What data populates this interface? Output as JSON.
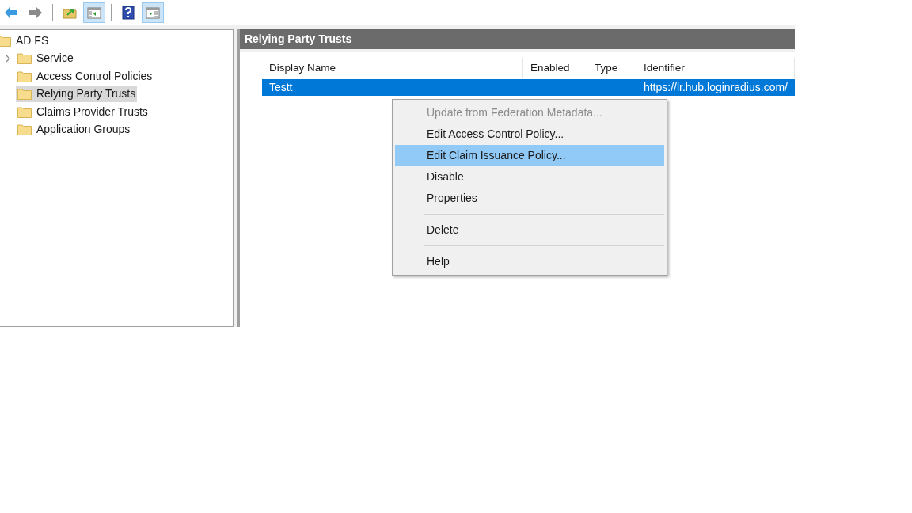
{
  "toolbar": [
    {
      "kind": "back",
      "pressed": false
    },
    {
      "kind": "forward",
      "pressed": false
    },
    {
      "kind": "sep"
    },
    {
      "kind": "up",
      "pressed": false
    },
    {
      "kind": "tree",
      "pressed": true
    },
    {
      "kind": "sep"
    },
    {
      "kind": "help",
      "pressed": false
    },
    {
      "kind": "action",
      "pressed": true
    }
  ],
  "tree": {
    "label": "AD FS",
    "selected": false,
    "children": [
      {
        "label": "Service",
        "expandable": true,
        "selected": false
      },
      {
        "label": "Access Control Policies",
        "expandable": false,
        "selected": false
      },
      {
        "label": "Relying Party Trusts",
        "expandable": false,
        "selected": true
      },
      {
        "label": "Claims Provider Trusts",
        "expandable": false,
        "selected": false
      },
      {
        "label": "Application Groups",
        "expandable": false,
        "selected": false
      }
    ]
  },
  "pane": {
    "title": "Relying Party Trusts",
    "columns": [
      "Display Name",
      "Enabled",
      "Type",
      "Identifier"
    ],
    "rows": [
      {
        "display_name": "Testt",
        "identifier": "https://lr.hub.loginradius.com/",
        "selected": true
      }
    ]
  },
  "context_menu": [
    {
      "kind": "item",
      "label": "Update from Federation Metadata...",
      "disabled": true,
      "selected": false
    },
    {
      "kind": "item",
      "label": "Edit Access Control Policy...",
      "disabled": false,
      "selected": false
    },
    {
      "kind": "item",
      "label": "Edit Claim Issuance Policy...",
      "disabled": false,
      "selected": true
    },
    {
      "kind": "item",
      "label": "Disable",
      "disabled": false,
      "selected": false
    },
    {
      "kind": "item",
      "label": "Properties",
      "disabled": false,
      "selected": false
    },
    {
      "kind": "separator"
    },
    {
      "kind": "item",
      "label": "Delete",
      "disabled": false,
      "selected": false
    },
    {
      "kind": "separator"
    },
    {
      "kind": "item",
      "label": "Help",
      "disabled": false,
      "selected": false
    }
  ]
}
